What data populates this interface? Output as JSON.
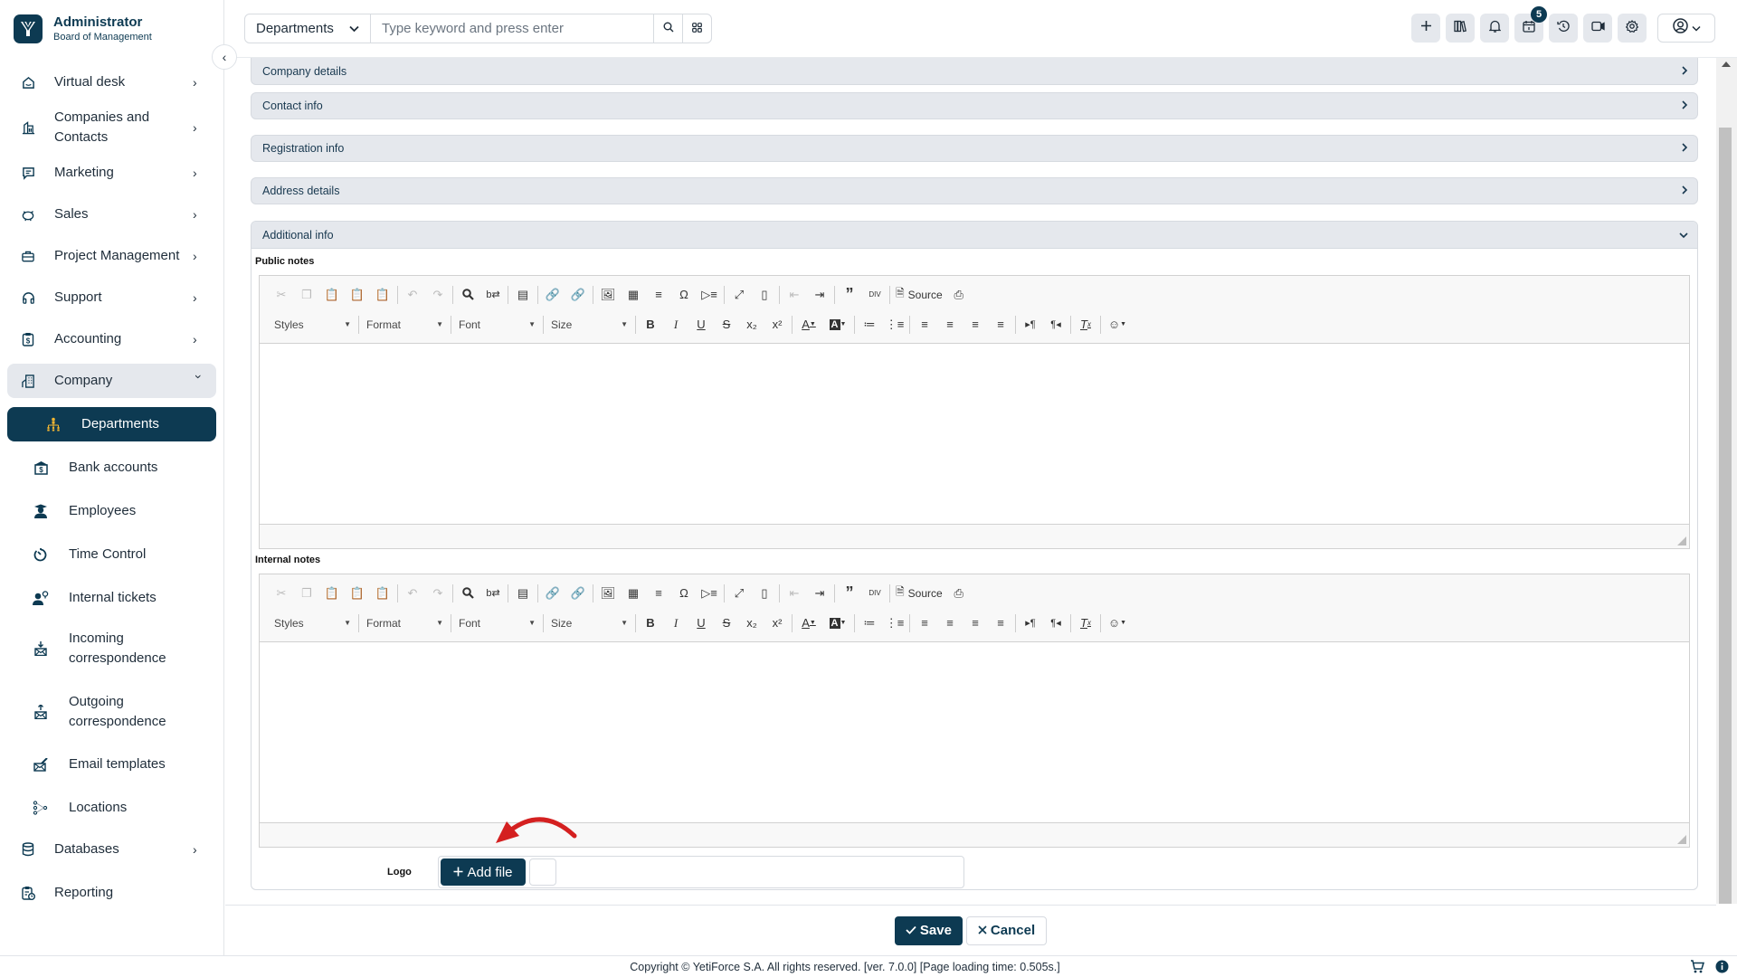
{
  "brand": {
    "title": "Administrator",
    "subtitle": "Board of Management"
  },
  "search": {
    "module": "Departments",
    "placeholder": "Type keyword and press enter"
  },
  "topbar": {
    "tools": [
      {
        "icon": "plus-icon",
        "label": "Quick create"
      },
      {
        "icon": "books-icon",
        "label": "Knowledge base"
      },
      {
        "icon": "bell-icon",
        "label": "Notifications"
      },
      {
        "icon": "calendar-icon",
        "label": "Reminders",
        "badge": "5"
      },
      {
        "icon": "history-icon",
        "label": "History"
      },
      {
        "icon": "video-icon",
        "label": "Meetings"
      },
      {
        "icon": "gear-icon",
        "label": "Settings"
      }
    ]
  },
  "sidebar": {
    "items": [
      {
        "label": "Virtual desk",
        "icon": "house-icon"
      },
      {
        "label": "Companies and Contacts",
        "icon": "building-icon"
      },
      {
        "label": "Marketing",
        "icon": "message-icon"
      },
      {
        "label": "Sales",
        "icon": "piggy-bank-icon"
      },
      {
        "label": "Project Management",
        "icon": "briefcase-icon"
      },
      {
        "label": "Support",
        "icon": "headphones-icon"
      },
      {
        "label": "Accounting",
        "icon": "clipboard-dollar-icon"
      },
      {
        "label": "Company",
        "icon": "company-icon"
      }
    ],
    "sub_items": [
      {
        "label": "Departments",
        "icon": "org-chart-icon"
      },
      {
        "label": "Bank accounts",
        "icon": "bank-icon"
      },
      {
        "label": "Employees",
        "icon": "employee-icon"
      },
      {
        "label": "Time Control",
        "icon": "stopwatch-icon"
      },
      {
        "label": "Internal tickets",
        "icon": "user-ticket-icon"
      },
      {
        "label": "Incoming correspondence",
        "icon": "mail-in-icon"
      },
      {
        "label": "Outgoing correspondence",
        "icon": "mail-out-icon"
      },
      {
        "label": "Email templates",
        "icon": "mail-template-icon"
      },
      {
        "label": "Locations",
        "icon": "locations-icon"
      }
    ],
    "bottom_items": [
      {
        "label": "Databases",
        "icon": "database-icon"
      },
      {
        "label": "Reporting",
        "icon": "report-icon"
      }
    ]
  },
  "blocks": [
    "Company details",
    "Contact info",
    "Registration info",
    "Address details"
  ],
  "additional": {
    "title": "Additional info",
    "public_notes_label": "Public notes",
    "internal_notes_label": "Internal notes",
    "public_notes_value": "",
    "internal_notes_value": "",
    "logo_label": "Logo",
    "add_file_label": "Add file"
  },
  "editor": {
    "combos": [
      "Styles",
      "Format",
      "Font",
      "Size"
    ],
    "source_label": "Source"
  },
  "actions": {
    "save": "Save",
    "cancel": "Cancel"
  },
  "footer": {
    "copyright": "Copyright © YetiForce S.A. All rights reserved. [ver. 7.0.0] [Page loading time: 0.505s.]"
  }
}
